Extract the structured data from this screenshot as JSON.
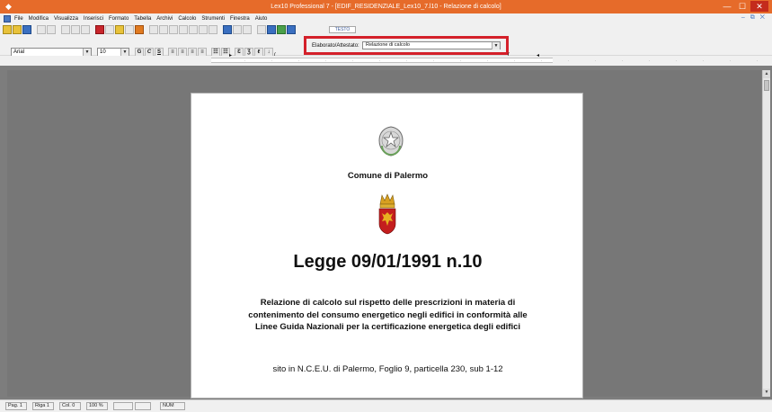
{
  "window": {
    "title": "Lex10 Professional 7 - [EDIF_RESIDENZIALE_Lex10_7.l10 - Relazione di calcolo]",
    "app_icon": "app-icon",
    "controls": [
      "—",
      "☐",
      "✕"
    ]
  },
  "menu": {
    "items": [
      "File",
      "Modifica",
      "Visualizza",
      "Inserisci",
      "Formato",
      "Tabella",
      "Archivi",
      "Calcolo",
      "Strumenti",
      "Finestra",
      "Aiuto"
    ],
    "mdi_controls": "– ⧉ ✕"
  },
  "toolbar": {
    "textbox_value": "TESTO"
  },
  "format_bar": {
    "font": "Arial",
    "size": "10",
    "buttons": [
      "G",
      "C",
      "S",
      "≡",
      "≡",
      "≡",
      "≡",
      "☷",
      "☷",
      "Ɛ",
      "Ʒ",
      "ℓ",
      "↓"
    ]
  },
  "elaborato": {
    "label": "Elaborato/Attestato:",
    "value": "Relazione di calcolo",
    "highlight_color": "#d4202a"
  },
  "document": {
    "comune": "Comune di Palermo",
    "title": "Legge 09/01/1991 n.10",
    "relazione": "Relazione di calcolo sul rispetto delle prescrizioni in materia di contenimento del consumo energetico negli edifici in conformità alle Linee Guida Nazionali per la certificazione energetica degli edifici",
    "sito": "sito in N.C.E.U. di Palermo, Foglio 9, particella 230, sub 1-12"
  },
  "status": {
    "pag": "Pag. 1",
    "riga": "Riga 1",
    "col": "Col. 0",
    "zoom": "100 %",
    "num": "NUM"
  },
  "colors": {
    "titlebar": "#e66b2a",
    "workspace": "#777777",
    "accent_red": "#d4202a"
  }
}
